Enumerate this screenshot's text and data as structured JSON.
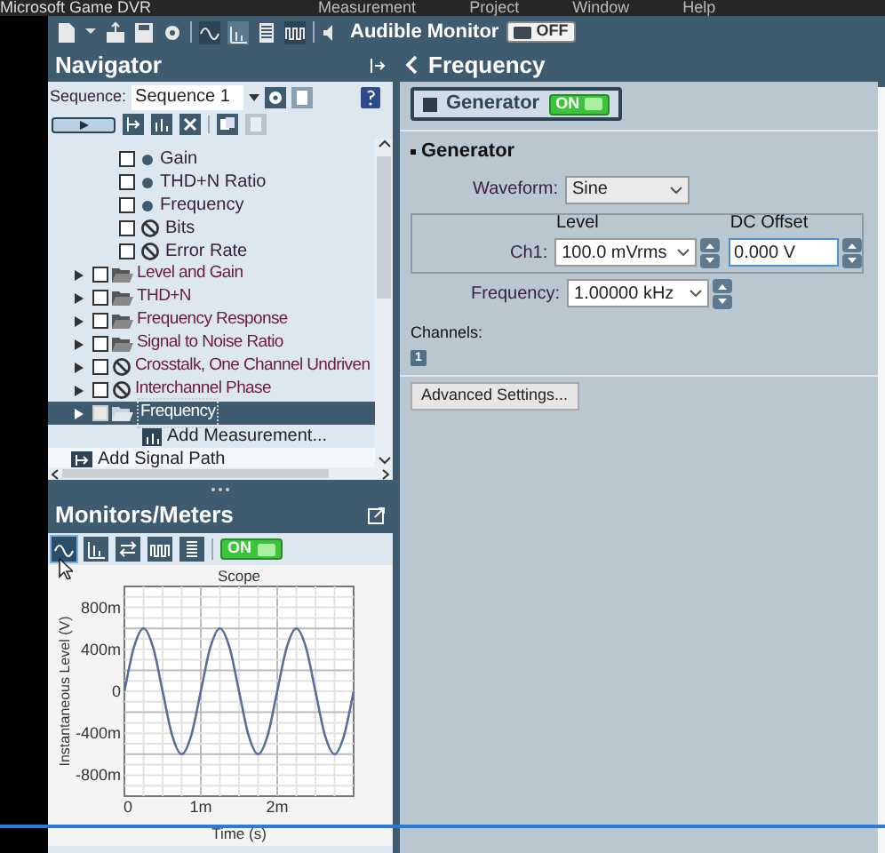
{
  "window": {
    "title": "Microsoft Game DVR"
  },
  "menu": [
    "Measurement",
    "Project",
    "Window",
    "Help"
  ],
  "toolbar": {
    "audible_label": "Audible Monitor",
    "audible_toggle": "OFF",
    "audible_on": false
  },
  "navigator": {
    "title": "Navigator",
    "sequence_label": "Sequence:",
    "sequence": "Sequence 1",
    "child_items": [
      {
        "label": "Gain",
        "kind": "dot",
        "checked": false
      },
      {
        "label": "THD+N Ratio",
        "kind": "dot",
        "checked": false
      },
      {
        "label": "Frequency",
        "kind": "dot",
        "checked": false
      },
      {
        "label": "Bits",
        "kind": "disabled",
        "checked": false
      },
      {
        "label": "Error Rate",
        "kind": "disabled",
        "checked": false
      }
    ],
    "items": [
      {
        "label": "Level and Gain",
        "kind": "folder",
        "checked": false,
        "expanded": false,
        "selected": false
      },
      {
        "label": "THD+N",
        "kind": "folder",
        "checked": false,
        "expanded": false,
        "selected": false
      },
      {
        "label": "Frequency Response",
        "kind": "folder",
        "checked": false,
        "expanded": false,
        "selected": false
      },
      {
        "label": "Signal to Noise Ratio",
        "kind": "folder",
        "checked": false,
        "expanded": false,
        "selected": false
      },
      {
        "label": "Crosstalk, One Channel Undriven",
        "kind": "disabled",
        "checked": false,
        "expanded": false,
        "selected": false
      },
      {
        "label": "Interchannel Phase",
        "kind": "disabled",
        "checked": false,
        "expanded": false,
        "selected": false
      },
      {
        "label": "Frequency",
        "kind": "folder",
        "checked": false,
        "expanded": false,
        "selected": true
      }
    ],
    "add_measurement": "Add Measurement...",
    "add_signal_path": "Add Signal Path"
  },
  "monitors": {
    "title": "Monitors/Meters",
    "toggle": "ON",
    "on": true,
    "tools": [
      {
        "selected": true
      },
      {
        "selected": false
      },
      {
        "selected": false
      },
      {
        "selected": false
      },
      {
        "selected": false
      }
    ],
    "chart_data": {
      "type": "line",
      "title": "Scope",
      "xlabel": "Time (s)",
      "ylabel": "Instantaneous Level (V)",
      "x": [
        0,
        0.125,
        0.25,
        0.375,
        0.5,
        0.625,
        0.75,
        0.875,
        1,
        1.125,
        1.25,
        1.375,
        1.5,
        1.625,
        1.75,
        1.875,
        2,
        2.125,
        2.25,
        2.375,
        2.5,
        2.625,
        2.75,
        2.875,
        3
      ],
      "series": [
        {
          "color": "#5a6e9a",
          "values": [
            0,
            420,
            600,
            420,
            0,
            -420,
            -600,
            -420,
            0,
            420,
            600,
            420,
            0,
            -420,
            -600,
            -420,
            0,
            420,
            600,
            420,
            0,
            -420,
            -600,
            -420,
            0
          ]
        }
      ],
      "xlim": [
        0,
        3
      ],
      "ylim": [
        -1000,
        1000
      ],
      "grid": true,
      "xticks": [
        {
          "value": 0,
          "label": "0"
        },
        {
          "value": 1,
          "label": "1m"
        },
        {
          "value": 2,
          "label": "2m"
        }
      ],
      "yticks": [
        {
          "value": -800,
          "label": "-800m"
        },
        {
          "value": -400,
          "label": "-400m"
        },
        {
          "value": 0,
          "label": "0"
        },
        {
          "value": 400,
          "label": "400m"
        },
        {
          "value": 800,
          "label": "800m"
        }
      ]
    }
  },
  "panel": {
    "title": "Frequency",
    "generator_button": "Generator",
    "generator_toggle": "ON",
    "generator_on": true,
    "section": "Generator",
    "waveform_label": "Waveform:",
    "waveform": "Sine",
    "level_header": "Level",
    "dc_offset_header": "DC Offset",
    "ch1_label": "Ch1:",
    "ch1_level_value": "100.0 mVrms",
    "dc_offset_value": "0.000 V",
    "frequency_label": "Frequency:",
    "frequency_value": "1.00000 kHz",
    "channels_label": "Channels:",
    "channels": [
      "1"
    ],
    "advanced_button": "Advanced Settings..."
  }
}
